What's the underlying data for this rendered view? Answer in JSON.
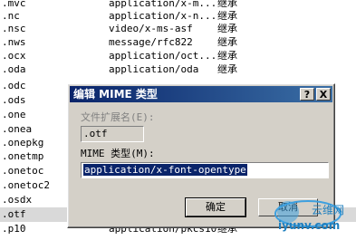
{
  "list": {
    "rows": [
      {
        "ext": ".mvc",
        "type": "application/x-m...",
        "mode": "继承"
      },
      {
        "ext": ".nc",
        "type": "application/x-n...",
        "mode": "继承"
      },
      {
        "ext": ".nsc",
        "type": "video/x-ms-asf",
        "mode": "继承"
      },
      {
        "ext": ".nws",
        "type": "message/rfc822",
        "mode": "继承"
      },
      {
        "ext": ".ocx",
        "type": "application/oct...",
        "mode": "继承"
      },
      {
        "ext": ".oda",
        "type": "application/oda",
        "mode": "继承"
      },
      {
        "ext": ".odc",
        "type": "",
        "mode": ""
      },
      {
        "ext": ".ods",
        "type": "",
        "mode": ""
      },
      {
        "ext": ".one",
        "type": "",
        "mode": ""
      },
      {
        "ext": ".onea",
        "type": "",
        "mode": ""
      },
      {
        "ext": ".onepkg",
        "type": "",
        "mode": ""
      },
      {
        "ext": ".onetmp",
        "type": "",
        "mode": ""
      },
      {
        "ext": ".onetoc",
        "type": "",
        "mode": ""
      },
      {
        "ext": ".onetoc2",
        "type": "",
        "mode": ""
      },
      {
        "ext": ".osdx",
        "type": "",
        "mode": ""
      },
      {
        "ext": ".otf",
        "type": "",
        "mode": ""
      },
      {
        "ext": ".p10",
        "type": "application/pkcs10",
        "mode": "继承"
      }
    ],
    "selected_index": 15
  },
  "dialog": {
    "title": "编辑 MIME 类型",
    "help_button": "?",
    "close_button": "X",
    "ext_label": "文件扩展名(E):",
    "ext_value": ".otf",
    "mime_label": "MIME 类型(M):",
    "mime_value": "application/x-font-opentype",
    "ok_label": "确定",
    "cancel_label": "取消"
  },
  "watermark": {
    "text": "iyunv.com",
    "brand": "云维网"
  },
  "colors": {
    "titlebar_start": "#0a246a",
    "titlebar_end": "#3a6ea5",
    "dialog_bg": "#d4d0c8",
    "selection": "#0a246a"
  }
}
